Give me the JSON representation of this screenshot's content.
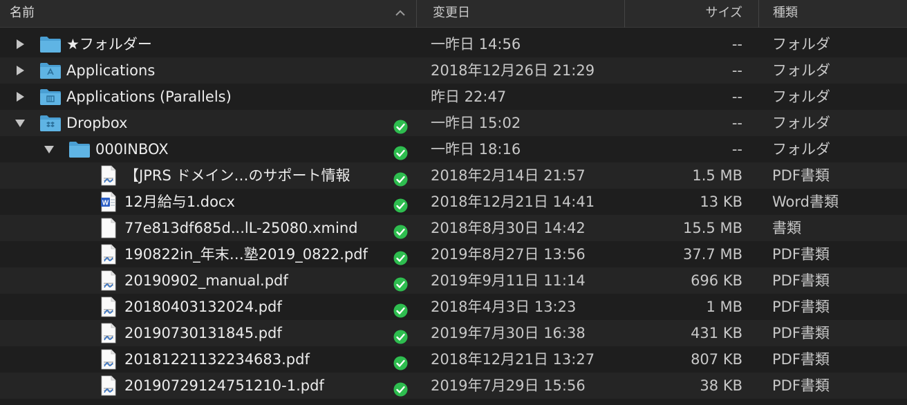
{
  "columns": {
    "name": "名前",
    "date": "変更日",
    "size": "サイズ",
    "kind": "種類"
  },
  "colors": {
    "folder": "#5fb4e4",
    "sync_ok": "#2ebd4f",
    "background": "#1e1e1e"
  },
  "rows": [
    {
      "name": "★フォルダー",
      "date": "一昨日 14:56",
      "size": "--",
      "kind": "フォルダ",
      "level": 0,
      "disclosure": "collapsed",
      "icon": "folder-icon",
      "synced": false
    },
    {
      "name": "Applications",
      "date": "2018年12月26日 21:29",
      "size": "--",
      "kind": "フォルダ",
      "level": 0,
      "disclosure": "collapsed",
      "icon": "applications-folder-icon",
      "synced": false
    },
    {
      "name": "Applications (Parallels)",
      "date": "昨日 22:47",
      "size": "--",
      "kind": "フォルダ",
      "level": 0,
      "disclosure": "collapsed",
      "icon": "parallels-folder-icon",
      "synced": false
    },
    {
      "name": "Dropbox",
      "date": "一昨日 15:02",
      "size": "--",
      "kind": "フォルダ",
      "level": 0,
      "disclosure": "expanded",
      "icon": "dropbox-folder-icon",
      "synced": true
    },
    {
      "name": "000INBOX",
      "date": "一昨日 18:16",
      "size": "--",
      "kind": "フォルダ",
      "level": 1,
      "disclosure": "expanded",
      "icon": "folder-icon",
      "synced": true
    },
    {
      "name": "【JPRS ドメイン…のサポート情報",
      "date": "2018年2月14日 21:57",
      "size": "1.5 MB",
      "kind": "PDF書類",
      "level": 2,
      "icon": "pdf-document-icon",
      "synced": true
    },
    {
      "name": "12月給与1.docx",
      "date": "2018年12月21日 14:41",
      "size": "13 KB",
      "kind": "Word書類",
      "level": 2,
      "icon": "word-document-icon",
      "synced": true
    },
    {
      "name": "77e813df685d...lL-25080.xmind",
      "date": "2018年8月30日 14:42",
      "size": "15.5 MB",
      "kind": "書類",
      "level": 2,
      "icon": "blank-document-icon",
      "synced": true
    },
    {
      "name": "190822in_年末…塾2019_0822.pdf",
      "date": "2019年8月27日 13:56",
      "size": "37.7 MB",
      "kind": "PDF書類",
      "level": 2,
      "icon": "pdf-document-icon",
      "synced": true
    },
    {
      "name": "20190902_manual.pdf",
      "date": "2019年9月11日 11:14",
      "size": "696 KB",
      "kind": "PDF書類",
      "level": 2,
      "icon": "pdf-document-icon",
      "synced": true
    },
    {
      "name": "20180403132024.pdf",
      "date": "2018年4月3日 13:23",
      "size": "1 MB",
      "kind": "PDF書類",
      "level": 2,
      "icon": "pdf-document-icon",
      "synced": true
    },
    {
      "name": "20190730131845.pdf",
      "date": "2019年7月30日 16:38",
      "size": "431 KB",
      "kind": "PDF書類",
      "level": 2,
      "icon": "pdf-document-icon",
      "synced": true
    },
    {
      "name": "20181221132234683.pdf",
      "date": "2018年12月21日 13:27",
      "size": "807 KB",
      "kind": "PDF書類",
      "level": 2,
      "icon": "pdf-document-icon",
      "synced": true
    },
    {
      "name": "20190729124751210-1.pdf",
      "date": "2019年7月29日 15:56",
      "size": "38 KB",
      "kind": "PDF書類",
      "level": 2,
      "icon": "pdf-document-icon",
      "synced": true
    }
  ]
}
